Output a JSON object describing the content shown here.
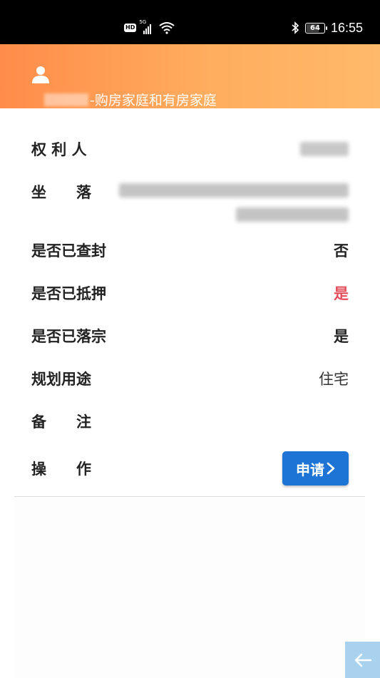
{
  "status_bar": {
    "hd": "HD",
    "network": "5G",
    "battery": "64",
    "battery_level": 0.64,
    "time": "16:55"
  },
  "header": {
    "title_suffix": "-购房家庭和有房家庭",
    "icon": "user-icon",
    "gradient": [
      "#ff8c4a",
      "#ffb96a"
    ]
  },
  "rows": {
    "owner": {
      "label": "权 利 人"
    },
    "location": {
      "label": "坐　　落"
    },
    "sealed": {
      "label": "是否已查封",
      "value": "否"
    },
    "mortgaged": {
      "label": "是否已抵押",
      "value": "是",
      "color": "#e34d59"
    },
    "settled": {
      "label": "是否已落宗",
      "value": "是"
    },
    "usage": {
      "label": "规划用途",
      "value": "住宅"
    },
    "remarks": {
      "label": "备　　注",
      "value": ""
    },
    "action": {
      "label": "操　　作",
      "button_label": "申请",
      "button_color": "#1d74d4"
    }
  },
  "back_button": {
    "icon": "arrow-left-icon",
    "color": "#a9d2ee"
  }
}
